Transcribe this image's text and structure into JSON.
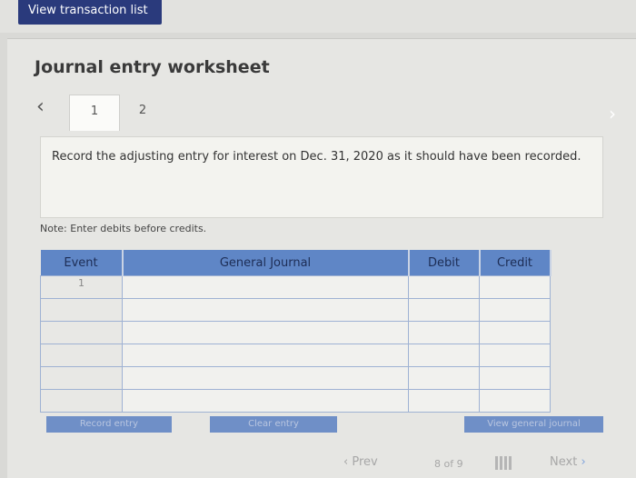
{
  "top_bar": {
    "view_transactions_label": "View transaction list"
  },
  "worksheet": {
    "title": "Journal entry worksheet",
    "tabs": [
      {
        "label": "1"
      },
      {
        "label": "2"
      }
    ],
    "prompt": "Record the adjusting entry for interest on Dec. 31, 2020 as it should have been recorded.",
    "note": "Note: Enter debits before credits."
  },
  "table": {
    "headers": {
      "event": "Event",
      "general_journal": "General Journal",
      "debit": "Debit",
      "credit": "Credit"
    },
    "first_event": "1"
  },
  "actions": {
    "record_entry": "Record entry",
    "clear_entry": "Clear entry",
    "view_general_journal": "View general journal"
  },
  "pager": {
    "prev": "Prev",
    "count": "8 of 9",
    "next": "Next"
  },
  "colors": {
    "nav_button": "#2a3a7c",
    "table_header": "#5f86c6",
    "action_button": "#6f8fc7"
  }
}
